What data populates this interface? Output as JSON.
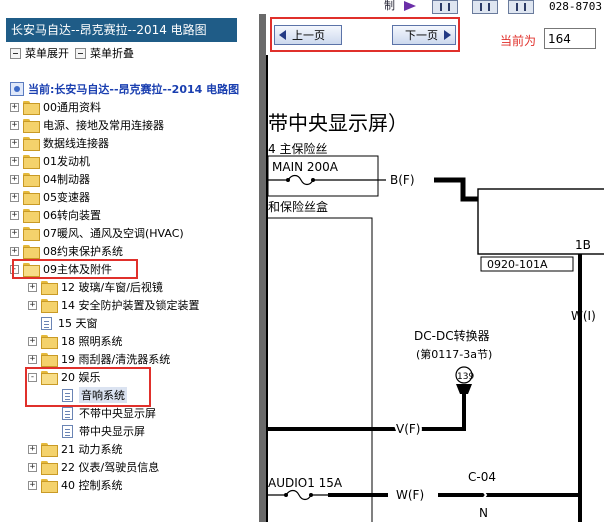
{
  "topstrip": {
    "tag": "制",
    "phone": "028-8703"
  },
  "left": {
    "title": "长安马自达--昂克赛拉--2014 电路图",
    "actions": {
      "expand": "菜单展开",
      "collapse": "菜单折叠"
    },
    "root": "当前:长安马自达--昂克赛拉--2014 电路图",
    "tree": [
      {
        "label": "00通用资料"
      },
      {
        "label": "电源、接地及常用连接器"
      },
      {
        "label": "数据线连接器"
      },
      {
        "label": "01发动机"
      },
      {
        "label": "04制动器"
      },
      {
        "label": "05变速器"
      },
      {
        "label": "06转向装置"
      },
      {
        "label": "07暖风、通风及空调(HVAC)"
      },
      {
        "label": "08约束保护系统"
      },
      {
        "label": "09主体及附件"
      },
      {
        "label": "12 玻璃/车窗/后视镜"
      },
      {
        "label": "14 安全防护装置及锁定装置"
      },
      {
        "label": "15 天窗"
      },
      {
        "label": "18 照明系统"
      },
      {
        "label": "19 雨刮器/清洗器系统"
      },
      {
        "label": "20 娱乐"
      },
      {
        "label": "音响系统"
      },
      {
        "label": "不带中央显示屏"
      },
      {
        "label": "带中央显示屏"
      },
      {
        "label": "21 动力系统"
      },
      {
        "label": "22 仪表/驾驶员信息"
      },
      {
        "label": "40 控制系统"
      }
    ]
  },
  "right": {
    "prev": "上一页",
    "next": "下一页",
    "current_label": "当前为",
    "current_page": "164"
  },
  "diagram": {
    "title": "带中央显示屏）",
    "fuse_header": "4  主保险丝",
    "main_fuse": "MAIN 200A",
    "bf_label": "B(F)",
    "fusebox_label": "和保险丝盒",
    "conn_1b": "1B",
    "conn_id": "0920-101A",
    "wi_label": "W(I)",
    "dcdc_title": "DC-DC转换器",
    "dcdc_ref": "(第0117-3a节)",
    "terminal_139": "139",
    "vf_label": "V(F)",
    "audio_fuse": "AUDIO1 15A",
    "wf_label": "W(F)",
    "c04_label": "C-04",
    "n_label": "N"
  }
}
